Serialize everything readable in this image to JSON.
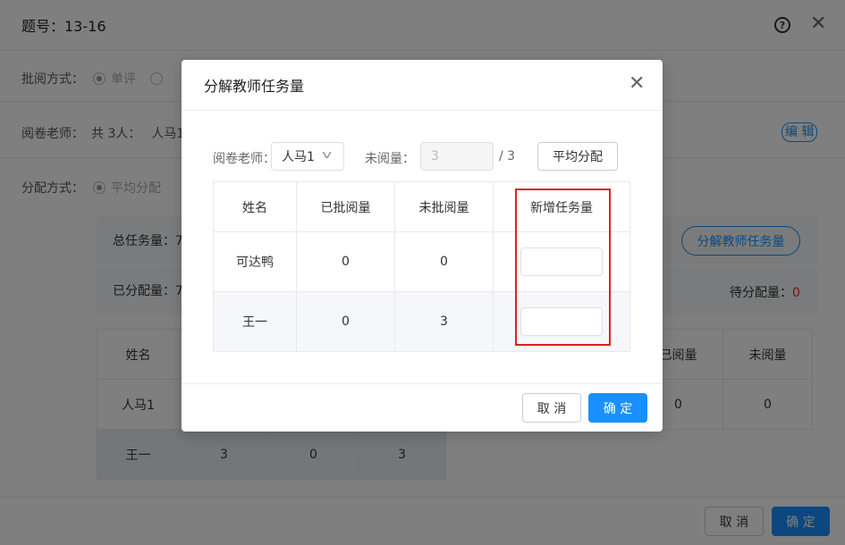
{
  "page": {
    "title": "题号：13-16",
    "help_icon": "?",
    "close_icon": "✕",
    "review_mode": {
      "label": "批阅方式：",
      "option1": "单评"
    },
    "teachers": {
      "label": "阅卷老师：",
      "count": "共 3人：",
      "first": "人马1",
      "edit": "编 辑"
    },
    "assign_mode": {
      "label": "分配方式：",
      "option1": "平均分配"
    },
    "total_tasks": "总任务量：7",
    "split_button": "分解教师任务量",
    "assigned": "已分配量：7",
    "pending_label": "待分配量：",
    "pending_value": "0",
    "table": {
      "name_header": "姓名",
      "rows": [
        {
          "name": "人马1"
        },
        {
          "name": "王一",
          "c1": "3",
          "c2": "0",
          "c3": "3"
        }
      ],
      "right_headers": [
        "已阅量",
        "未阅量"
      ],
      "right_row1": [
        "0",
        "0"
      ]
    },
    "cancel": "取 消",
    "confirm": "确 定"
  },
  "modal": {
    "title": "分解教师任务量",
    "close_icon": "✕",
    "teacher_label": "阅卷老师：",
    "teacher_selected": "人马1",
    "unread_label": "未阅量：",
    "unread_value": "3",
    "unread_total": "/ 3",
    "average_button": "平均分配",
    "columns": [
      "姓名",
      "已批阅量",
      "未批阅量",
      "新增任务量"
    ],
    "rows": [
      {
        "name": "可达鸭",
        "done": "0",
        "todo": "0",
        "new": ""
      },
      {
        "name": "王一",
        "done": "0",
        "todo": "3",
        "new": ""
      }
    ],
    "cancel": "取 消",
    "confirm": "确 定"
  }
}
